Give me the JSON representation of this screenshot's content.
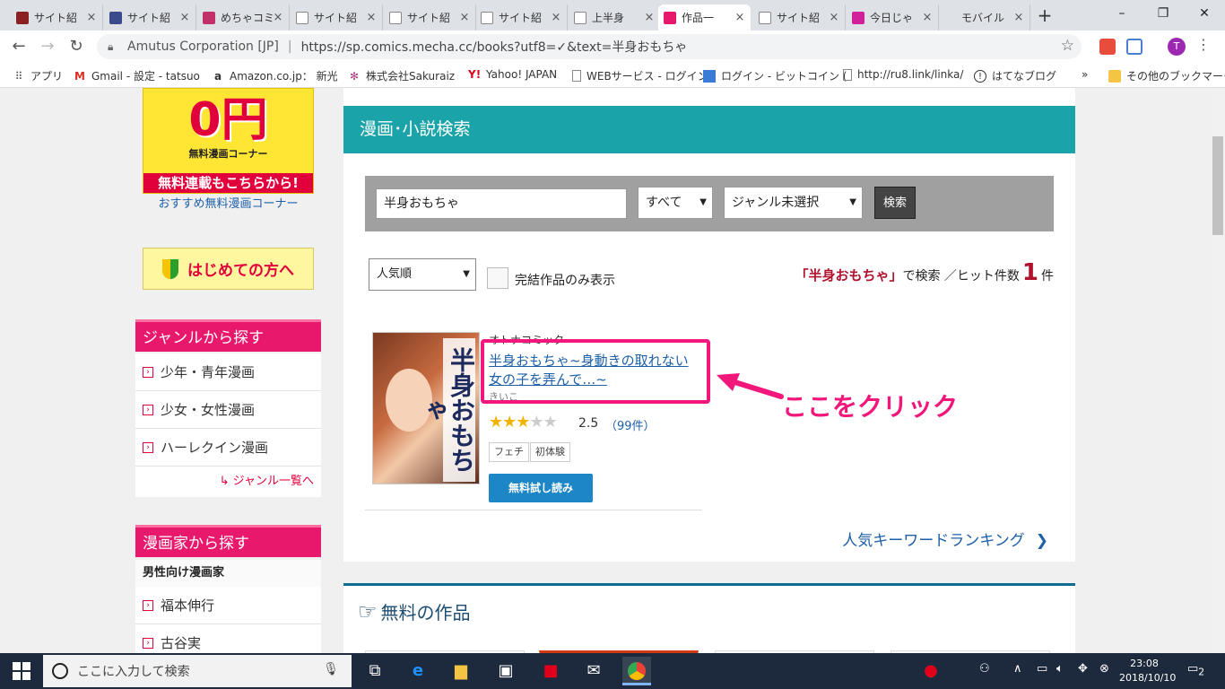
{
  "tabs": [
    {
      "title": "サイト紹",
      "color": "#8a2020"
    },
    {
      "title": "サイト紹",
      "color": "#3a4a8a"
    },
    {
      "title": "めちゃコミ",
      "color": "#c0306a"
    },
    {
      "title": "サイト紹",
      "color": "#888888"
    },
    {
      "title": "サイト紹",
      "color": "#888888"
    },
    {
      "title": "サイト紹",
      "color": "#888888"
    },
    {
      "title": "上半身",
      "color": "#888888"
    },
    {
      "title": "作品一",
      "color": "#e8186c"
    },
    {
      "title": "サイト紹",
      "color": "#888888"
    },
    {
      "title": "今日じゃ",
      "color": "#d0209a"
    },
    {
      "title": "モバイル",
      "color": "#888888"
    }
  ],
  "browser": {
    "org": "Amutus Corporation [JP]",
    "url": "https://sp.comics.mecha.cc/books?utf8=✓&text=半身おもちゃ",
    "avatar": "T"
  },
  "bookmarks": [
    {
      "label": "アプリ",
      "icon": "apps-icon"
    },
    {
      "label": "Gmail - 設定 - tatsuo",
      "icon": "gmail-icon"
    },
    {
      "label": "Amazon.co.jp： 新光",
      "icon": "amazon-icon"
    },
    {
      "label": "株式会社Sakuraiz",
      "icon": "sakuraiz-icon"
    },
    {
      "label": "Yahoo! JAPAN",
      "icon": "yahoo-icon"
    },
    {
      "label": "WEBサービス - ログイン",
      "icon": "page-icon"
    },
    {
      "label": "ログイン - ビットコイン (",
      "icon": "bitcoin-icon"
    },
    {
      "label": "http://ru8.link/linka/",
      "icon": "page-icon"
    },
    {
      "label": "はてなブログ",
      "icon": "hatena-icon"
    },
    {
      "label": "»",
      "icon": "more-icon"
    },
    {
      "label": "その他のブックマーク",
      "icon": "folder-icon"
    }
  ],
  "sidebar": {
    "free_banner": {
      "zero": "0円",
      "line1": "無料漫画コーナー",
      "line2": "無料連載もこちらから!"
    },
    "recommend_link": "おすすめ無料漫画コーナー",
    "beginner": "はじめての方へ",
    "genre_heading": "ジャンルから探す",
    "genres": [
      "少年・青年漫画",
      "少女・女性漫画",
      "ハーレクイン漫画"
    ],
    "genre_all": "↳ ジャンル一覧へ",
    "artist_heading": "漫画家から探す",
    "artist_sub": "男性向け漫画家",
    "artists": [
      "福本伸行",
      "古谷実"
    ]
  },
  "main": {
    "title": "漫画･小説検索",
    "query": "半身おもちゃ",
    "category": "すべて",
    "genre": "ジャンル未選択",
    "search_button": "検索",
    "sort": "人気順",
    "complete_only": "完結作品のみ表示",
    "hits": {
      "keyword": "「半身おもちゃ」",
      "middle": "で検索 ／ヒット件数",
      "count": "1",
      "unit": "件"
    }
  },
  "result": {
    "label": "オトナコミック",
    "cover_title": "半身おもちゃ",
    "title": "半身おもちゃ~身動きの取れない女の子を弄んで…~",
    "author": "きいこ",
    "rating": "2.5",
    "rating_value": 2.5,
    "reviews": "（99件）",
    "tags": [
      "フェチ",
      "初体験"
    ],
    "free_button": "無料試し読み"
  },
  "ranking_link": "人気キーワードランキング",
  "annotation": {
    "text": "ここをクリック",
    "color": "#f2177a"
  },
  "free_section": {
    "title": "無料の作品"
  },
  "taskbar": {
    "search_placeholder": "ここに入力して検索",
    "time": "23:08",
    "date": "2018/10/10",
    "notifications": "2"
  }
}
